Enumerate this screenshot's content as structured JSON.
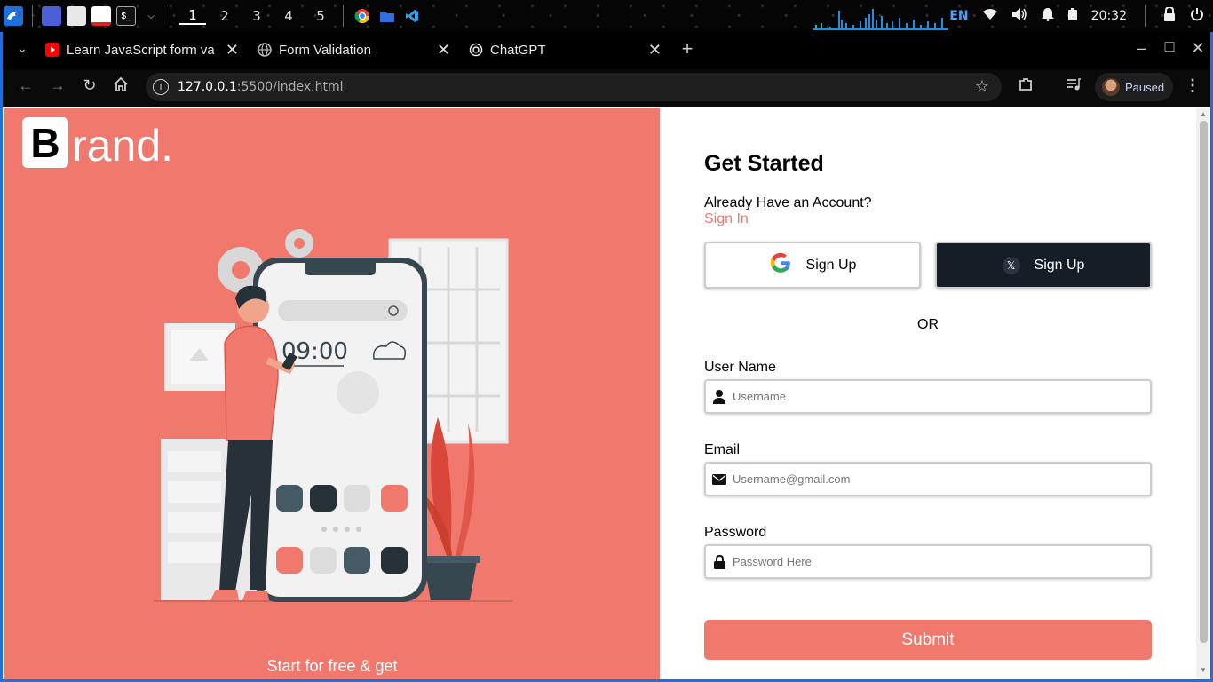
{
  "taskbar": {
    "workspaces": [
      "1",
      "2",
      "3",
      "4",
      "5"
    ],
    "active_workspace": "1",
    "language": "EN",
    "clock": "20:32",
    "icons": [
      "kali-menu-icon",
      "desktop-icon",
      "file-manager-icon",
      "text-editor-icon",
      "terminal-icon",
      "chevron-down-icon",
      "chrome-icon",
      "folder-icon",
      "vscode-icon",
      "wifi-icon",
      "volume-icon",
      "bell-icon",
      "battery-icon",
      "lock-icon",
      "power-icon"
    ]
  },
  "browser": {
    "tabs": [
      {
        "title": "Learn JavaScript form val",
        "icon": "youtube-icon"
      },
      {
        "title": "Form Validation",
        "icon": "globe-icon",
        "active": true
      },
      {
        "title": "ChatGPT",
        "icon": "chatgpt-icon"
      }
    ],
    "new_tab": "+",
    "url_host": "127.0.0.1",
    "url_path": ":5500/index.html",
    "profile_status": "Paused",
    "window_controls": {
      "minimize": "–",
      "maximize": "□",
      "close": "✕"
    }
  },
  "page": {
    "brand": {
      "first_letter": "B",
      "rest": "rand."
    },
    "illustration": {
      "clock": "09:00"
    },
    "tagline": "Start for free & get",
    "form": {
      "title": "Get Started",
      "already": "Already Have an Account?",
      "signin": "Sign In",
      "google_button": "Sign Up",
      "x_button": "Sign Up",
      "or": "OR",
      "username_label": "User Name",
      "username_placeholder": "Username",
      "email_label": "Email",
      "email_placeholder": "Username@gmail.com",
      "password_label": "Password",
      "password_placeholder": "Password Here",
      "submit": "Submit"
    },
    "colors": {
      "accent": "#f1786c",
      "dark_button": "#151d26",
      "browser_border": "#1e6fd9"
    }
  }
}
